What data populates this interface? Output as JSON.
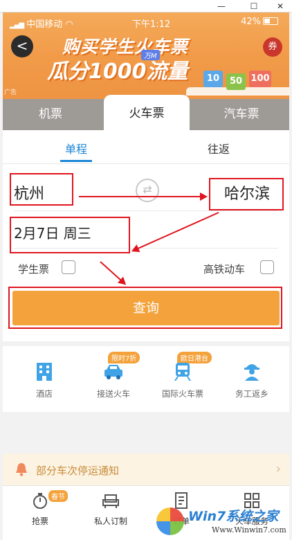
{
  "window": {
    "minimize": "—",
    "maximize": "☐",
    "close": "✕"
  },
  "status_bar": {
    "carrier": "中国移动",
    "time": "下午1:12",
    "battery": "42%"
  },
  "banner": {
    "back_label": "<",
    "promo_line1": "购买学生火车票",
    "promo_tag": "万M",
    "promo_line2": "瓜分1000流量",
    "coupon_label": "券",
    "ad_label": "广告",
    "gifts": [
      "10",
      "50",
      "100"
    ]
  },
  "transport_tabs": [
    {
      "label": "机票",
      "active": false
    },
    {
      "label": "火车票",
      "active": true
    },
    {
      "label": "汽车票",
      "active": false
    }
  ],
  "trip_type": [
    {
      "label": "单程",
      "active": true
    },
    {
      "label": "往返",
      "active": false
    }
  ],
  "form": {
    "from_city": "杭州",
    "to_city": "哈尔滨",
    "swap_icon": "⇄",
    "date": "2月7日 周三",
    "student_ticket_label": "学生票",
    "high_speed_label": "高铁动车",
    "search_label": "查询"
  },
  "services": [
    {
      "label": "酒店",
      "badge": "",
      "icon": "building-icon"
    },
    {
      "label": "接送火车",
      "badge": "限时7折",
      "icon": "car-icon"
    },
    {
      "label": "国际火车票",
      "badge": "欧日港台",
      "icon": "train-icon"
    },
    {
      "label": "务工返乡",
      "badge": "",
      "icon": "worker-icon"
    }
  ],
  "notice": {
    "text": "部分车次停运通知"
  },
  "bottom_nav": [
    {
      "label": "抢票",
      "badge": "春节",
      "icon": "stopwatch-icon"
    },
    {
      "label": "私人订制",
      "badge": "",
      "icon": "sofa-icon"
    },
    {
      "label": "订单",
      "badge": "",
      "icon": "document-icon"
    },
    {
      "label": "火车服务",
      "badge": "",
      "icon": "grid-icon"
    }
  ],
  "watermark": {
    "title": "Win7系统之家",
    "url": "Www.Winwin7.com"
  },
  "colors": {
    "accent": "#f3a23c",
    "link": "#1a86d7",
    "annotation": "#e0141e"
  }
}
